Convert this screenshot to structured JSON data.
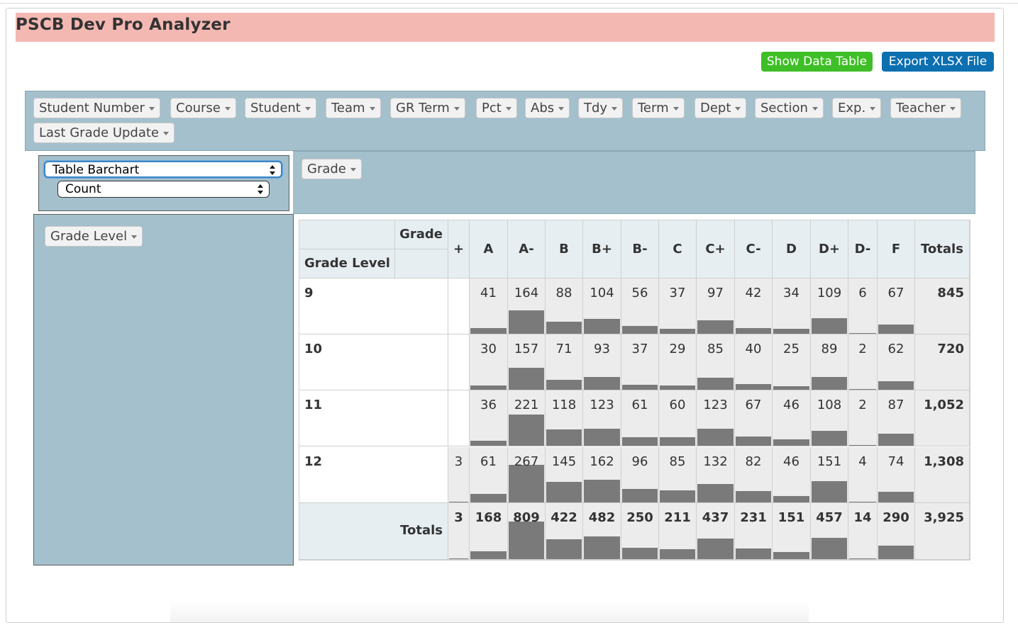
{
  "app": {
    "title": "PSCB Dev Pro Analyzer"
  },
  "toolbar": {
    "show_data_table": "Show Data Table",
    "export_xlsx": "Export XLSX File"
  },
  "attributes": [
    "Student Number",
    "Course",
    "Student",
    "Team",
    "GR Term",
    "Pct",
    "Abs",
    "Tdy",
    "Term",
    "Dept",
    "Section",
    "Exp.",
    "Teacher",
    "Last Grade Update"
  ],
  "renderer": {
    "selected": "Table Barchart",
    "aggregator": "Count"
  },
  "cols_attr": "Grade",
  "rows_attr": "Grade Level",
  "table": {
    "col_axis_label": "Grade",
    "row_axis_label": "Grade Level",
    "totals_label": "Totals",
    "columns": [
      "+",
      "A",
      "A-",
      "B",
      "B+",
      "B-",
      "C",
      "C+",
      "C-",
      "D",
      "D+",
      "D-",
      "F"
    ],
    "rows": [
      {
        "label": "9",
        "values": [
          "",
          "41",
          "164",
          "88",
          "104",
          "56",
          "37",
          "97",
          "42",
          "34",
          "109",
          "6",
          "67"
        ],
        "total": "845"
      },
      {
        "label": "10",
        "values": [
          "",
          "30",
          "157",
          "71",
          "93",
          "37",
          "29",
          "85",
          "40",
          "25",
          "89",
          "2",
          "62"
        ],
        "total": "720"
      },
      {
        "label": "11",
        "values": [
          "",
          "36",
          "221",
          "118",
          "123",
          "61",
          "60",
          "123",
          "67",
          "46",
          "108",
          "2",
          "87"
        ],
        "total": "1,052"
      },
      {
        "label": "12",
        "values": [
          "3",
          "61",
          "267",
          "145",
          "162",
          "96",
          "85",
          "132",
          "82",
          "46",
          "151",
          "4",
          "74"
        ],
        "total": "1,308"
      }
    ],
    "column_totals": [
      "3",
      "168",
      "809",
      "422",
      "482",
      "250",
      "211",
      "437",
      "231",
      "151",
      "457",
      "14",
      "290"
    ],
    "grand_total": "3,925"
  }
}
